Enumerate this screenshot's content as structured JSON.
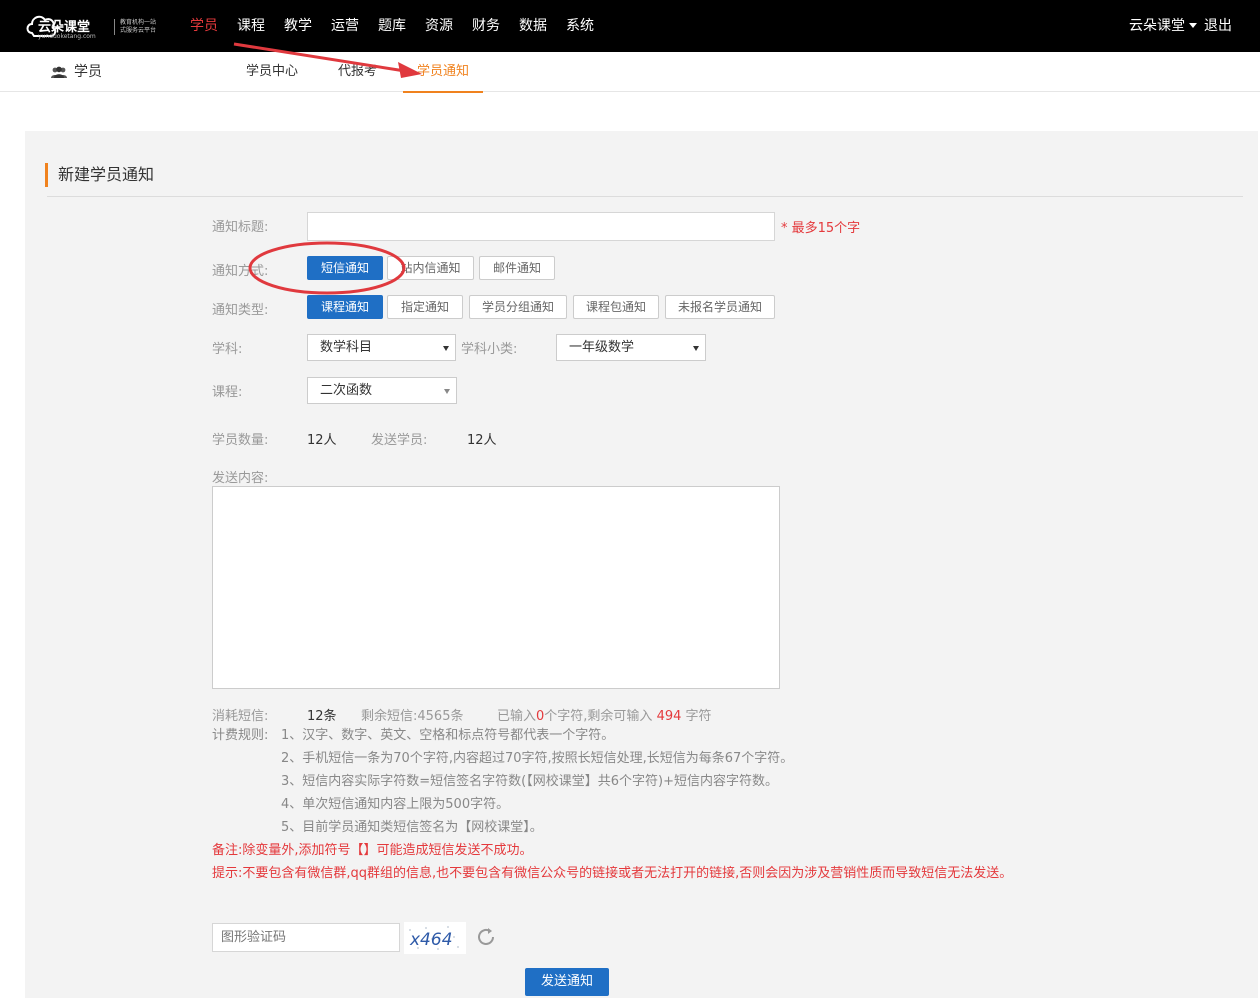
{
  "brand": {
    "name": "云朵课堂",
    "domain": "yunduoketang.com",
    "tagline": "教育机构一站式服务云平台"
  },
  "main_nav": [
    {
      "label": "学员",
      "active": true
    },
    {
      "label": "课程"
    },
    {
      "label": "教学"
    },
    {
      "label": "运营"
    },
    {
      "label": "题库"
    },
    {
      "label": "资源"
    },
    {
      "label": "财务"
    },
    {
      "label": "数据"
    },
    {
      "label": "系统"
    }
  ],
  "user": {
    "name": "云朵课堂",
    "logout": "退出"
  },
  "subnav": {
    "section": "学员",
    "tabs": [
      {
        "label": "学员中心"
      },
      {
        "label": "代报考"
      },
      {
        "label": "学员通知",
        "active": true
      }
    ]
  },
  "form": {
    "title": "新建学员通知",
    "notice_title_label": "通知标题:",
    "notice_title_value": "",
    "notice_title_hint": "* 最多15个字",
    "method_label": "通知方式:",
    "methods": [
      "短信通知",
      "站内信通知",
      "邮件通知"
    ],
    "type_label": "通知类型:",
    "types": [
      "课程通知",
      "指定通知",
      "学员分组通知",
      "课程包通知",
      "未报名学员通知"
    ],
    "subject_label": "学科:",
    "subject_value": "数学科目",
    "subcat_label": "学科小类:",
    "subcat_value": "一年级数学",
    "course_label": "课程:",
    "course_value": "二次函数",
    "student_count_label": "学员数量:",
    "student_count_value": "12人",
    "send_students_label": "发送学员:",
    "send_students_value": "12人",
    "content_label": "发送内容:",
    "sms_used_label": "消耗短信:",
    "sms_used_value": "12条",
    "sms_remaining": "剩余短信:4565条",
    "typed_prefix": "已输入",
    "typed_count": "0",
    "typed_mid": "个字符,剩余可输入",
    "remaining_chars": "494",
    "remaining_suffix": "字符",
    "billing_label": "计费规则:",
    "rules": [
      "1、汉字、数字、英文、空格和标点符号都代表一个字符。",
      "2、手机短信一条为70个字符,内容超过70字符,按照长短信处理,长短信为每条67个字符。",
      "3、短信内容实际字符数=短信签名字符数(【网校课堂】共6个字符)+短信内容字符数。",
      "4、单次短信通知内容上限为500字符。",
      "5、目前学员通知类短信签名为【网校课堂】。"
    ],
    "note": "备注:除变量外,添加符号【】可能造成短信发送不成功。",
    "tip": "提示:不要包含有微信群,qq群组的信息,也不要包含有微信公众号的链接或者无法打开的链接,否则会因为涉及营销性质而导致短信无法发送。",
    "captcha_placeholder": "图形验证码",
    "captcha_text": "x464",
    "send_button": "发送通知"
  },
  "colors": {
    "accent_orange": "#f0821e",
    "primary_blue": "#1f6fc5",
    "warning_red": "#e4393c",
    "annotation_red": "#e0393e"
  }
}
